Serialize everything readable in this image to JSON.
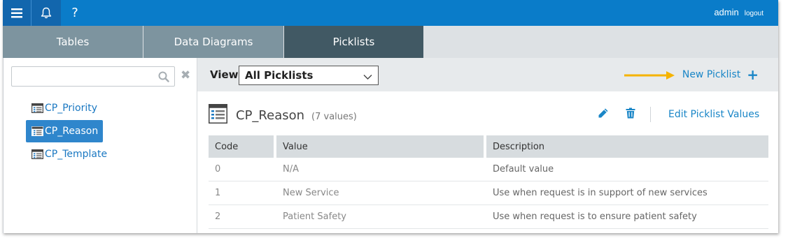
{
  "topbar": {
    "menu_icon": "hamburger-menu-icon",
    "bell_icon": "bell-icon",
    "help_label": "?",
    "user_name": "admin",
    "logout_label": "logout"
  },
  "tabs": [
    {
      "label": "Tables"
    },
    {
      "label": "Data Diagrams"
    },
    {
      "label": "Picklists",
      "active": true
    }
  ],
  "sidebar": {
    "search_value": "",
    "search_placeholder": "",
    "items": [
      {
        "label": "CP_Priority"
      },
      {
        "label": "CP_Reason",
        "active": true
      },
      {
        "label": "CP_Template"
      }
    ]
  },
  "toolbar": {
    "view_label": "View",
    "view_selected": "All Picklists",
    "new_picklist_label": "New Picklist",
    "new_picklist_plus": "+"
  },
  "picklist": {
    "name": "CP_Reason",
    "count_text": "(7 values)",
    "edit_values_label": "Edit Picklist Values"
  },
  "table": {
    "columns": [
      "Code",
      "Value",
      "Description"
    ],
    "rows": [
      {
        "code": "0",
        "value": "N/A",
        "description": "Default value"
      },
      {
        "code": "1",
        "value": "New Service",
        "description": "Use when request is in support of new services"
      },
      {
        "code": "2",
        "value": "Patient Safety",
        "description": "Use when request is to ensure patient safety"
      }
    ]
  },
  "colors": {
    "topbar": "#0a7cc9",
    "tab_inactive": "#7d949f",
    "tab_active": "#415964",
    "accent": "#1a86c7",
    "highlight_arrow": "#f5b300"
  }
}
